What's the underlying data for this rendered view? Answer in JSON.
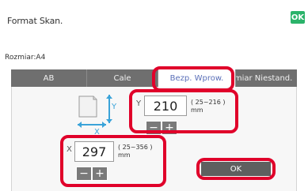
{
  "header": {
    "title": "Format Skan.",
    "ok_label": "OK"
  },
  "size": {
    "label": "Rozmiar:A4"
  },
  "tabs": [
    {
      "label": "AB"
    },
    {
      "label": "Cale"
    },
    {
      "label": "Bezp. Wprow."
    },
    {
      "label": "Rozmiar Niestand."
    }
  ],
  "y_field": {
    "axis": "Y",
    "value": "210",
    "range": "( 25~216 )",
    "unit": "mm"
  },
  "x_field": {
    "axis": "X",
    "value": "297",
    "range": "( 25~356 )",
    "unit": "mm"
  },
  "stepper": {
    "minus": "−",
    "plus": "+"
  },
  "footer": {
    "ok_label": "OK"
  },
  "colors": {
    "ok_green": "#2bb36a",
    "highlight_red": "#e0002a",
    "tab_gray": "#6f6f6f"
  }
}
